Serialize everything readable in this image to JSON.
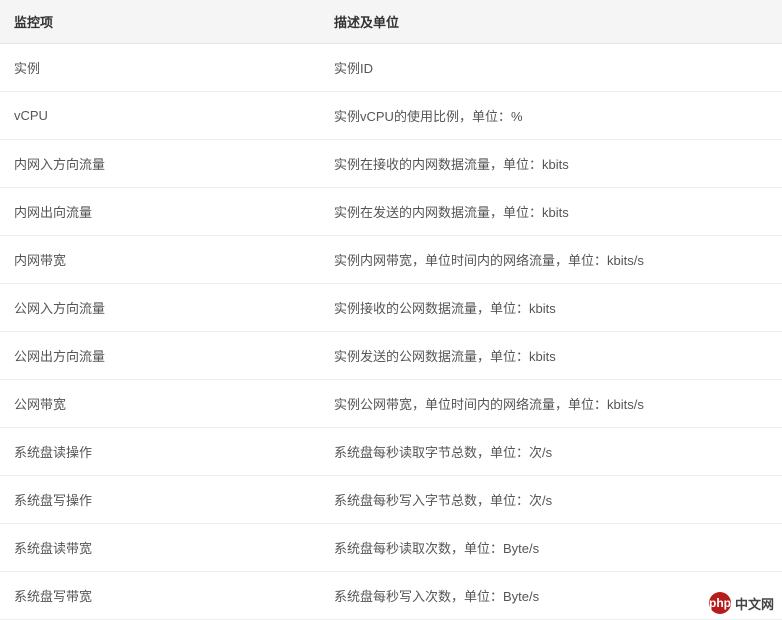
{
  "table": {
    "headers": {
      "item": "监控项",
      "desc": "描述及单位"
    },
    "rows": [
      {
        "item": "实例",
        "desc": "实例ID"
      },
      {
        "item": "vCPU",
        "desc": "实例vCPU的使用比例，单位：%"
      },
      {
        "item": "内网入方向流量",
        "desc": "实例在接收的内网数据流量，单位：kbits"
      },
      {
        "item": "内网出向流量",
        "desc": "实例在发送的内网数据流量，单位：kbits"
      },
      {
        "item": "内网带宽",
        "desc": "实例内网带宽，单位时间内的网络流量，单位：kbits/s"
      },
      {
        "item": "公网入方向流量",
        "desc": "实例接收的公网数据流量，单位：kbits"
      },
      {
        "item": "公网出方向流量",
        "desc": "实例发送的公网数据流量，单位：kbits"
      },
      {
        "item": "公网带宽",
        "desc": "实例公网带宽，单位时间内的网络流量，单位：kbits/s"
      },
      {
        "item": "系统盘读操作",
        "desc": "系统盘每秒读取字节总数，单位：次/s"
      },
      {
        "item": "系统盘写操作",
        "desc": "系统盘每秒写入字节总数，单位：次/s"
      },
      {
        "item": "系统盘读带宽",
        "desc": "系统盘每秒读取次数，单位：Byte/s"
      },
      {
        "item": "系统盘写带宽",
        "desc": "系统盘每秒写入次数，单位：Byte/s"
      }
    ]
  },
  "watermark": {
    "badge": "php",
    "text": "中文网"
  }
}
